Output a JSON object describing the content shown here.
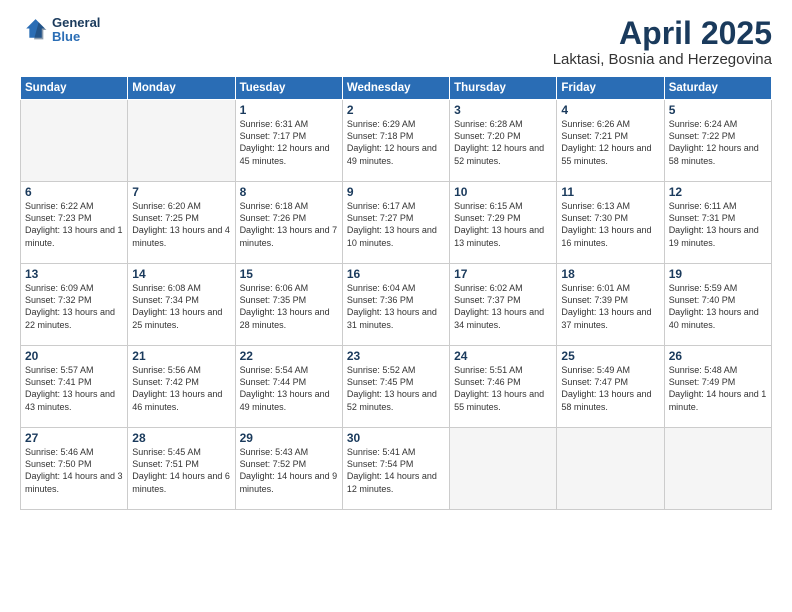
{
  "header": {
    "logo_line1": "General",
    "logo_line2": "Blue",
    "month_title": "April 2025",
    "location": "Laktasi, Bosnia and Herzegovina"
  },
  "days_of_week": [
    "Sunday",
    "Monday",
    "Tuesday",
    "Wednesday",
    "Thursday",
    "Friday",
    "Saturday"
  ],
  "weeks": [
    [
      {
        "day": "",
        "info": ""
      },
      {
        "day": "",
        "info": ""
      },
      {
        "day": "1",
        "info": "Sunrise: 6:31 AM\nSunset: 7:17 PM\nDaylight: 12 hours and 45 minutes."
      },
      {
        "day": "2",
        "info": "Sunrise: 6:29 AM\nSunset: 7:18 PM\nDaylight: 12 hours and 49 minutes."
      },
      {
        "day": "3",
        "info": "Sunrise: 6:28 AM\nSunset: 7:20 PM\nDaylight: 12 hours and 52 minutes."
      },
      {
        "day": "4",
        "info": "Sunrise: 6:26 AM\nSunset: 7:21 PM\nDaylight: 12 hours and 55 minutes."
      },
      {
        "day": "5",
        "info": "Sunrise: 6:24 AM\nSunset: 7:22 PM\nDaylight: 12 hours and 58 minutes."
      }
    ],
    [
      {
        "day": "6",
        "info": "Sunrise: 6:22 AM\nSunset: 7:23 PM\nDaylight: 13 hours and 1 minute."
      },
      {
        "day": "7",
        "info": "Sunrise: 6:20 AM\nSunset: 7:25 PM\nDaylight: 13 hours and 4 minutes."
      },
      {
        "day": "8",
        "info": "Sunrise: 6:18 AM\nSunset: 7:26 PM\nDaylight: 13 hours and 7 minutes."
      },
      {
        "day": "9",
        "info": "Sunrise: 6:17 AM\nSunset: 7:27 PM\nDaylight: 13 hours and 10 minutes."
      },
      {
        "day": "10",
        "info": "Sunrise: 6:15 AM\nSunset: 7:29 PM\nDaylight: 13 hours and 13 minutes."
      },
      {
        "day": "11",
        "info": "Sunrise: 6:13 AM\nSunset: 7:30 PM\nDaylight: 13 hours and 16 minutes."
      },
      {
        "day": "12",
        "info": "Sunrise: 6:11 AM\nSunset: 7:31 PM\nDaylight: 13 hours and 19 minutes."
      }
    ],
    [
      {
        "day": "13",
        "info": "Sunrise: 6:09 AM\nSunset: 7:32 PM\nDaylight: 13 hours and 22 minutes."
      },
      {
        "day": "14",
        "info": "Sunrise: 6:08 AM\nSunset: 7:34 PM\nDaylight: 13 hours and 25 minutes."
      },
      {
        "day": "15",
        "info": "Sunrise: 6:06 AM\nSunset: 7:35 PM\nDaylight: 13 hours and 28 minutes."
      },
      {
        "day": "16",
        "info": "Sunrise: 6:04 AM\nSunset: 7:36 PM\nDaylight: 13 hours and 31 minutes."
      },
      {
        "day": "17",
        "info": "Sunrise: 6:02 AM\nSunset: 7:37 PM\nDaylight: 13 hours and 34 minutes."
      },
      {
        "day": "18",
        "info": "Sunrise: 6:01 AM\nSunset: 7:39 PM\nDaylight: 13 hours and 37 minutes."
      },
      {
        "day": "19",
        "info": "Sunrise: 5:59 AM\nSunset: 7:40 PM\nDaylight: 13 hours and 40 minutes."
      }
    ],
    [
      {
        "day": "20",
        "info": "Sunrise: 5:57 AM\nSunset: 7:41 PM\nDaylight: 13 hours and 43 minutes."
      },
      {
        "day": "21",
        "info": "Sunrise: 5:56 AM\nSunset: 7:42 PM\nDaylight: 13 hours and 46 minutes."
      },
      {
        "day": "22",
        "info": "Sunrise: 5:54 AM\nSunset: 7:44 PM\nDaylight: 13 hours and 49 minutes."
      },
      {
        "day": "23",
        "info": "Sunrise: 5:52 AM\nSunset: 7:45 PM\nDaylight: 13 hours and 52 minutes."
      },
      {
        "day": "24",
        "info": "Sunrise: 5:51 AM\nSunset: 7:46 PM\nDaylight: 13 hours and 55 minutes."
      },
      {
        "day": "25",
        "info": "Sunrise: 5:49 AM\nSunset: 7:47 PM\nDaylight: 13 hours and 58 minutes."
      },
      {
        "day": "26",
        "info": "Sunrise: 5:48 AM\nSunset: 7:49 PM\nDaylight: 14 hours and 1 minute."
      }
    ],
    [
      {
        "day": "27",
        "info": "Sunrise: 5:46 AM\nSunset: 7:50 PM\nDaylight: 14 hours and 3 minutes."
      },
      {
        "day": "28",
        "info": "Sunrise: 5:45 AM\nSunset: 7:51 PM\nDaylight: 14 hours and 6 minutes."
      },
      {
        "day": "29",
        "info": "Sunrise: 5:43 AM\nSunset: 7:52 PM\nDaylight: 14 hours and 9 minutes."
      },
      {
        "day": "30",
        "info": "Sunrise: 5:41 AM\nSunset: 7:54 PM\nDaylight: 14 hours and 12 minutes."
      },
      {
        "day": "",
        "info": ""
      },
      {
        "day": "",
        "info": ""
      },
      {
        "day": "",
        "info": ""
      }
    ]
  ]
}
